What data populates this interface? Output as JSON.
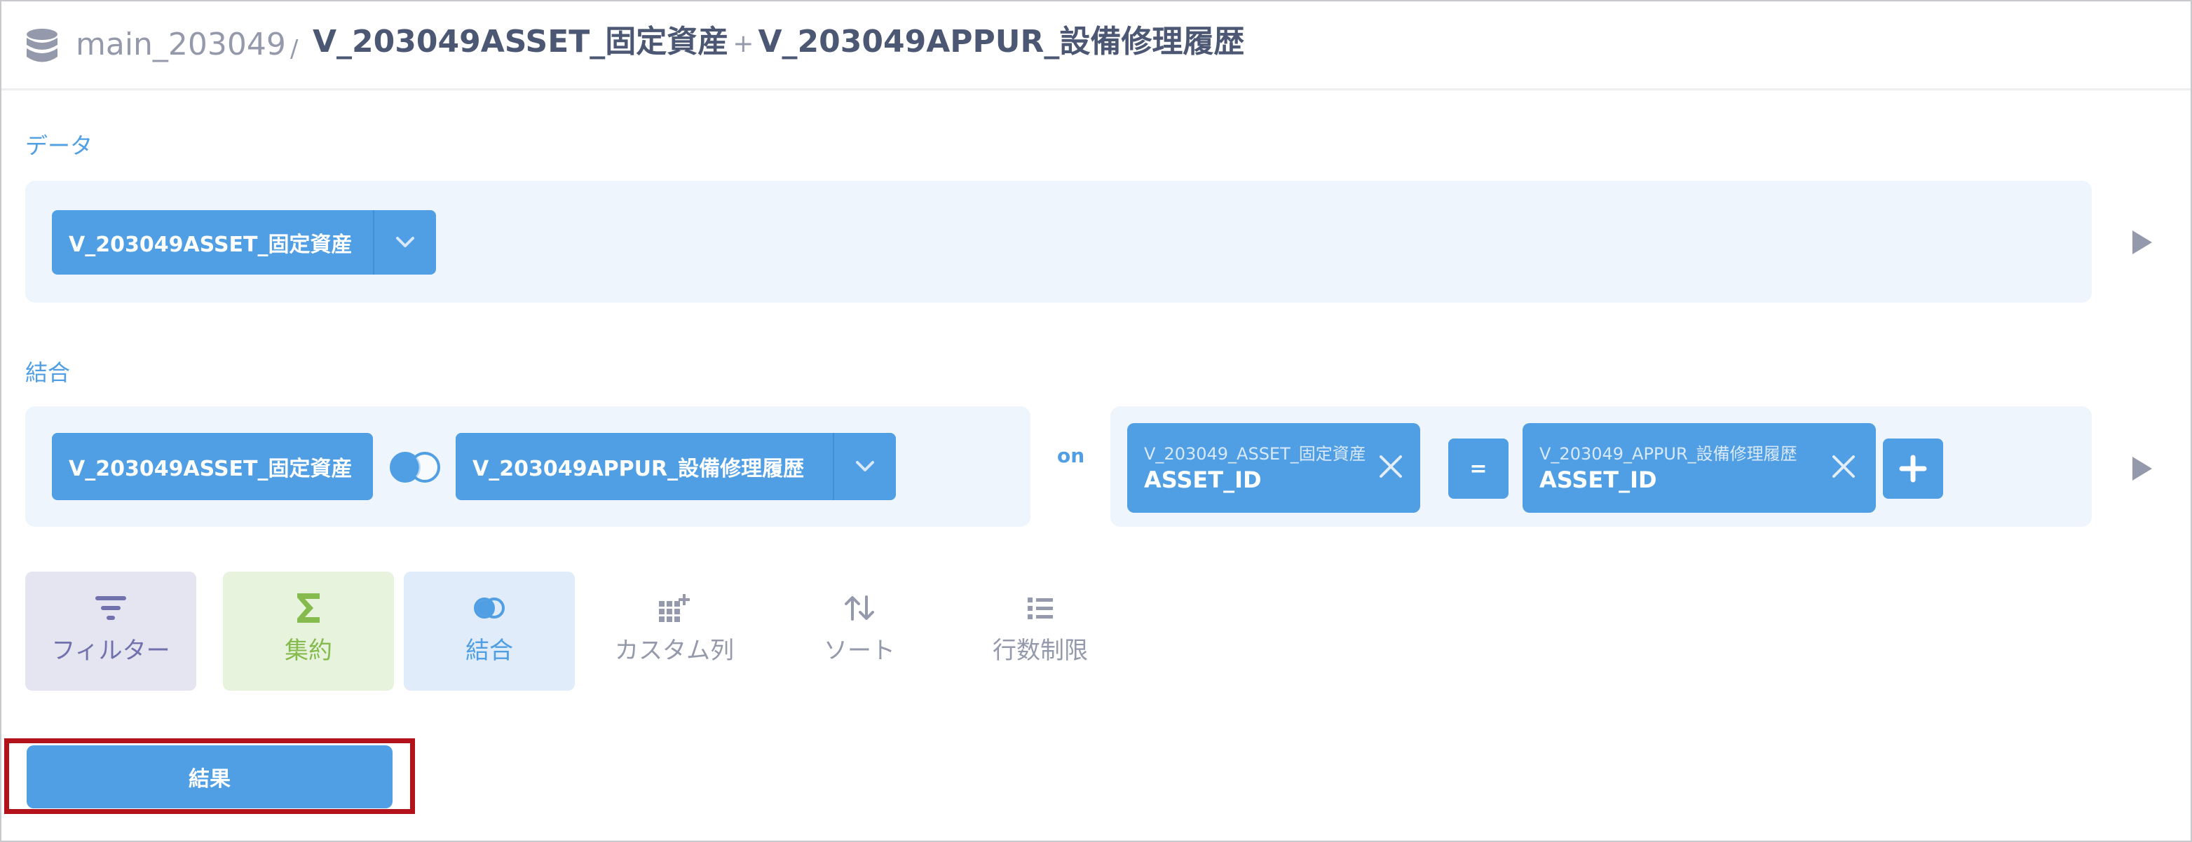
{
  "header": {
    "database": "main_203049",
    "separator": "/",
    "title_left": "V_203049ASSET_固定資産",
    "title_plus": "+",
    "title_right": "V_203049APPUR_設備修理履歴"
  },
  "data_step": {
    "label": "データ",
    "table": "V_203049ASSET_固定資産"
  },
  "join_step": {
    "label": "結合",
    "left_table": "V_203049ASSET_固定資産",
    "right_table": "V_203049APPUR_設備修理履歴",
    "on_label": "on",
    "left_condition": {
      "table": "V_203049_ASSET_固定資産",
      "column": "ASSET_ID"
    },
    "operator": "=",
    "right_condition": {
      "table": "V_203049_APPUR_設備修理履歴",
      "column": "ASSET_ID"
    }
  },
  "actions": [
    {
      "name": "filter",
      "label": "フィルター",
      "icon": "filter-icon",
      "color": "#7172ad",
      "bg": "#e5e4f1"
    },
    {
      "name": "summarize",
      "label": "集約",
      "icon": "sigma-icon",
      "color": "#84bb4c",
      "bg": "#e8f3de"
    },
    {
      "name": "join",
      "label": "結合",
      "icon": "join-icon",
      "color": "#509ee3",
      "bg": "#e0ecf9"
    },
    {
      "name": "custom-column",
      "label": "カスタム列",
      "icon": "grid-plus-icon",
      "color": "#949aab"
    },
    {
      "name": "sort",
      "label": "ソート",
      "icon": "sort-arrows-icon",
      "color": "#949aab"
    },
    {
      "name": "row-limit",
      "label": "行数制限",
      "icon": "list-icon",
      "color": "#949aab"
    }
  ],
  "result_button": {
    "label": "結果"
  },
  "colors": {
    "brand": "#509ee3",
    "highlight": "#b3121b"
  }
}
